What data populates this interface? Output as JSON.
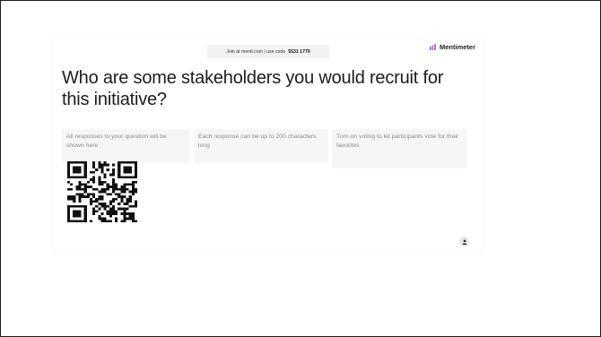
{
  "join_bar": {
    "text": "Join at menti.com | use code",
    "code": "5531 1770"
  },
  "brand": {
    "name": "Mentimeter",
    "logo_color": "#5a6cf3"
  },
  "question": "Who are some stakeholders you would recruit for this initiative?",
  "hints": [
    "All responses to your question will be shown here",
    "Each response can be up to 200 characters long",
    "Turn on voting to let participants vote for their favorites"
  ],
  "icons": {
    "qr": "qr-code-icon",
    "participants": "person-icon"
  }
}
